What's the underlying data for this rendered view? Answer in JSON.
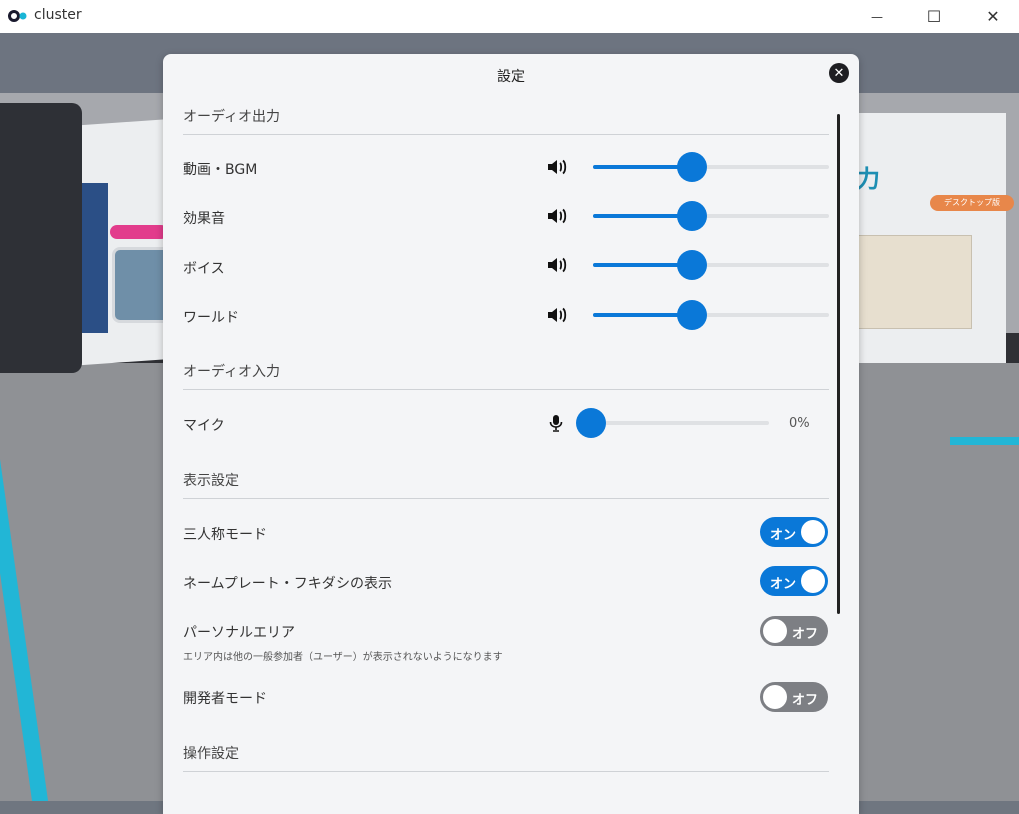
{
  "window": {
    "title": "cluster",
    "minimize_glyph": "—",
    "maximize_glyph": "☐",
    "close_glyph": "✕"
  },
  "world": {
    "big_title": "力",
    "orange_tag": "デスクトップ版"
  },
  "settings": {
    "title": "設定",
    "close_glyph": "✕",
    "audio_output": {
      "header": "オーディオ出力",
      "rows": [
        {
          "label": "動画・BGM",
          "value": 0.42,
          "icon": "speaker-icon"
        },
        {
          "label": "効果音",
          "value": 0.42,
          "icon": "speaker-icon"
        },
        {
          "label": "ボイス",
          "value": 0.42,
          "icon": "speaker-icon"
        },
        {
          "label": "ワールド",
          "value": 0.42,
          "icon": "speaker-icon"
        }
      ]
    },
    "audio_input": {
      "header": "オーディオ入力",
      "mic": {
        "label": "マイク",
        "value": 0.0,
        "percent_text": "0%",
        "icon": "microphone-icon"
      }
    },
    "display": {
      "header": "表示設定",
      "third_person": {
        "label": "三人称モード",
        "state": "on",
        "toggle_text": "オン"
      },
      "nameplate": {
        "label": "ネームプレート・フキダシの表示",
        "state": "on",
        "toggle_text": "オン"
      },
      "personal_area": {
        "label": "パーソナルエリア",
        "description": "エリア内は他の一般参加者（ユーザー）が表示されないようになります",
        "state": "off",
        "toggle_text": "オフ"
      },
      "developer_mode": {
        "label": "開発者モード",
        "state": "off",
        "toggle_text": "オフ"
      }
    },
    "controls": {
      "header": "操作設定"
    }
  },
  "colors": {
    "accent": "#0a78d8",
    "toggle_off": "#7d7f84",
    "panel_bg": "#f4f5f7"
  }
}
